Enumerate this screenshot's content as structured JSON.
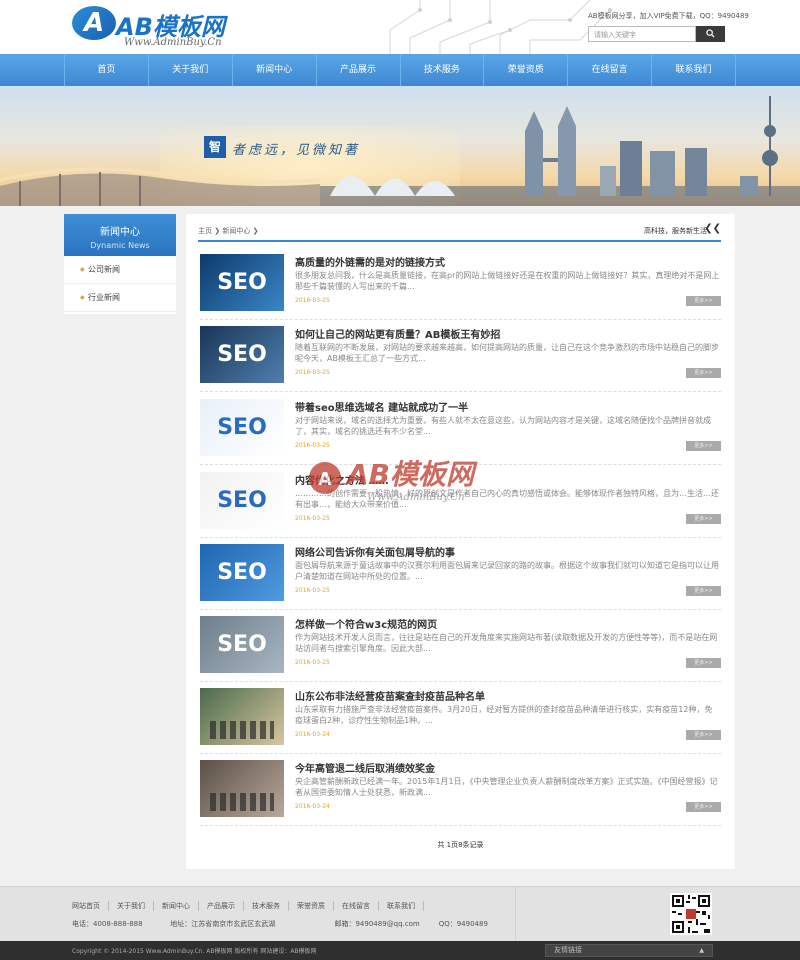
{
  "header": {
    "logo_letter": "A",
    "logo_text": "AB模板网",
    "logo_sub": "Www.AdminBuy.Cn",
    "top_links": "AB模板网分享，加入VIP免费下载，QQ：9490489",
    "search_placeholder": "请输入关键字",
    "search_icon": "magnifier-icon"
  },
  "nav": {
    "items": [
      "首页",
      "关于我们",
      "新闻中心",
      "产品展示",
      "技术服务",
      "荣誉资质",
      "在线留言",
      "联系我们"
    ]
  },
  "banner": {
    "mark": "智",
    "slogan": "者虑远，见微知著"
  },
  "sidebar": {
    "title": "新闻中心",
    "subtitle": "Dynamic News",
    "items": [
      "公司新闻",
      "行业新闻"
    ]
  },
  "main": {
    "breadcrumb": [
      "主页",
      "新闻中心"
    ],
    "tagline": "高科技，服务新生活",
    "arrows": "❮❮",
    "more_label": "更多>>",
    "news": [
      {
        "title": "高质量的外链需的是对的链接方式",
        "desc": "很多朋友总问我，什么是高质量链接，在高pr的网站上做链接好还是在权重的网站上做链接好？其实，真理绝对不是网上那些千篇装懂的人写出来的千篇...",
        "date": "2016-03-25",
        "thumb": "SEO"
      },
      {
        "title": "如何让自己的网站更有质量？AB模板王有妙招",
        "desc": "随着互联网的不断发展，对网站的要求越来越高，如何提高网站的质量，让自己在这个竞争激烈的市场中站稳自己的脚步呢今天，AB模板王汇总了一些方式...",
        "date": "2016-03-25",
        "thumb": "SEO"
      },
      {
        "title": "带着seo思维选域名 建站就成功了一半",
        "desc": "对于网站来说，域名的选择尤为重要，有些人就不太在意这些，认为网站内容才是关键，这域名随便找个品牌拼音就成了，其实，域名的挑选还有不少名堂...",
        "date": "2016-03-25",
        "thumb": "SEO"
      },
      {
        "title": "内容优化之方法 ……",
        "desc": "…………的创作需要一股热情，好的原创文是作者自己内心的真切感悟或体会。能够体现作者独特风格，且为…生活…还有出事…，能给大众带来价值...",
        "date": "2016-03-25",
        "thumb": "SEO"
      },
      {
        "title": "网络公司告诉你有关面包屑导航的事",
        "desc": "面包屑导航来源于童话故事中的汉赛尔利用面包屑来记录回家的路的故事。根据这个故事我们就可以知道它是指可以让用户清楚知道在网站中所处的位置。...",
        "date": "2016-03-25",
        "thumb": "SEO"
      },
      {
        "title": "怎样做一个符合w3c规范的网页",
        "desc": "作为网站技术开发人员而言，往往是站在自己的开发角度来实施网站布著(读取数据及开发的方便性等等)，而不是站在网站访问者与搜索引擎角度。因此大部...",
        "date": "2016-03-25",
        "thumb": "SEO"
      },
      {
        "title": "山东公布非法经营疫苗案查封疫苗品种名单",
        "desc": "山东采取有力措施严查非法经营疫苗案件。3月20日，经对暂方提供的查封疫苗品种清单进行核实，实有疫苗12种，免疫球蛋白2种，诊疗性生物制品1种。...",
        "date": "2016-03-24",
        "thumb": ""
      },
      {
        "title": "今年高管退二线后取消绩效奖金",
        "desc": "央企高管薪酬新政已经满一年。2015年1月1日，《中央管理企业负责人薪酬制度改革方案》正式实施。《中国经营报》记者从国资委知情人士处获悉，新政满...",
        "date": "2016-03-24",
        "thumb": ""
      }
    ],
    "pager": "共 1页8条记录"
  },
  "watermark": {
    "text": "AB模板网",
    "sub": "Www.AdminBuy.Cn"
  },
  "footer": {
    "links": [
      "网站首页",
      "关于我们",
      "新闻中心",
      "产品展示",
      "技术服务",
      "荣誉资质",
      "在线留言",
      "联系我们"
    ],
    "phone": "电话：4008-888-888",
    "address": "地址：江苏省南京市玄武区玄武湖",
    "email": "邮箱：9490489@qq.com",
    "qq": "QQ：9490489",
    "copyright": "Copyright © 2014-2015 Www.AdminBuy.Cn. AB模板网 版权所有  网站建设：AB模板网",
    "friend_links": "友情链接",
    "friend_arrow": "▲"
  },
  "colors": {
    "brand": "#3d88d2",
    "accent": "#e8a020"
  }
}
